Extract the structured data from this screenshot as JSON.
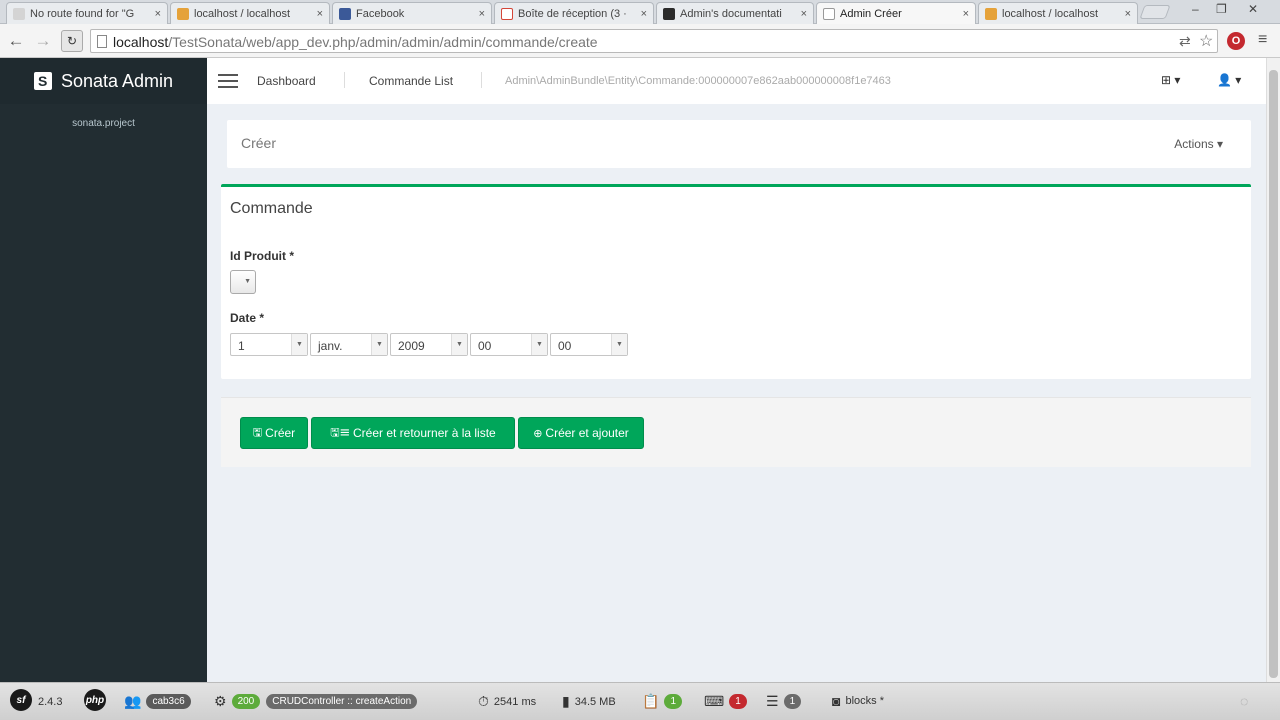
{
  "browser": {
    "tabs": [
      {
        "title": "No route found for \"G",
        "active": false,
        "favicon_color": "#c9c9c9"
      },
      {
        "title": "localhost / localhost",
        "active": false,
        "favicon_color": "#e5a23a"
      },
      {
        "title": "Facebook",
        "active": false,
        "favicon_color": "#3b5998"
      },
      {
        "title": "Boîte de réception (3 ·",
        "active": false,
        "favicon_color": "#d44638"
      },
      {
        "title": "Admin's documentati",
        "active": false,
        "favicon_color": "#2b2b2b"
      },
      {
        "title": "Admin Créer",
        "active": true,
        "favicon_color": "#ffffff"
      },
      {
        "title": "localhost / localhost",
        "active": false,
        "favicon_color": "#e5a23a"
      }
    ],
    "tab_close": "×",
    "window_controls": {
      "minimize": "–",
      "maximize": "❐",
      "close": "✕"
    },
    "url_host": "localhost",
    "url_path": "/TestSonata/web/app_dev.php/admin/admin/admin/commande/create",
    "back": "←",
    "forward": "→",
    "reload": "↻",
    "translate_icon": "translate-icon",
    "star_icon": "☆",
    "extension_letter": "O",
    "menu_glyph": "≡"
  },
  "sidebar": {
    "brand": "Sonata Admin",
    "subtitle": "sonata.project"
  },
  "navbar": {
    "breadcrumbs": [
      "Dashboard",
      "Commande List",
      "Admin\\AdminBundle\\Entity\\Commande:000000007e862aab000000008f1e7463"
    ],
    "add_menu": "⊞ ▾",
    "user_menu": "👤 ▾"
  },
  "page": {
    "title": "Créer",
    "actions": "Actions ▾"
  },
  "form": {
    "box_title": "Commande",
    "fields": {
      "id_produit_label": "Id Produit *",
      "date_label": "Date *",
      "date_values": [
        "1",
        "janv.",
        "2009",
        "00",
        "00"
      ]
    }
  },
  "buttons": {
    "create": "Créer",
    "create_return": "Créer et retourner à la liste",
    "create_add": "Créer et ajouter"
  },
  "debug_toolbar": {
    "symfony_version": "2.4.3",
    "php_label": "php",
    "token": "cab3c6",
    "status_code": "200",
    "controller": "CRUDController :: createAction",
    "time": "2541 ms",
    "memory": "34.5 MB",
    "forms_count": "1",
    "logs_count": "1",
    "queries_count": "1",
    "blocks": "blocks *"
  },
  "colors": {
    "accent_green": "#00a65a",
    "sidebar_bg": "#222d32",
    "content_bg": "#ecf0f5"
  }
}
